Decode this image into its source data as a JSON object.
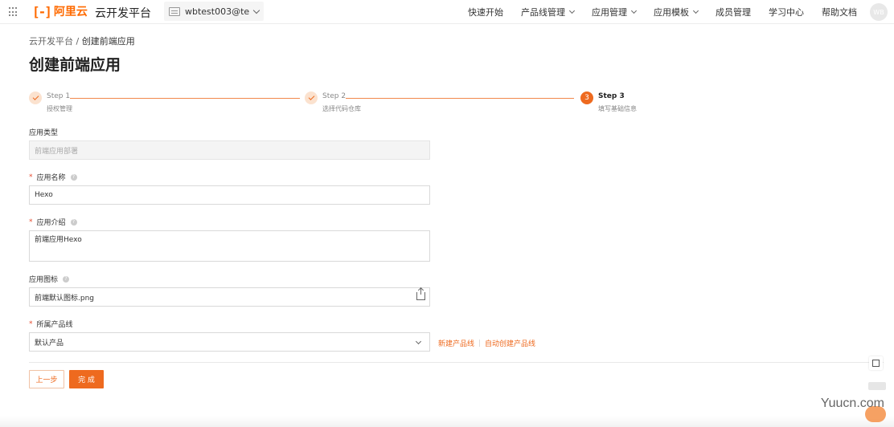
{
  "topbar": {
    "logo_mark": "[-]",
    "logo_text": "阿里云",
    "platform": "云开发平台",
    "account": "wbtest003@te...",
    "nav": [
      {
        "label": "快速开始",
        "dropdown": false
      },
      {
        "label": "产品线管理",
        "dropdown": true
      },
      {
        "label": "应用管理",
        "dropdown": true
      },
      {
        "label": "应用模板",
        "dropdown": true
      },
      {
        "label": "成员管理",
        "dropdown": false
      },
      {
        "label": "学习中心",
        "dropdown": false
      },
      {
        "label": "帮助文档",
        "dropdown": false
      }
    ],
    "avatar": "WB"
  },
  "breadcrumb": {
    "root": "云开发平台",
    "sep": " / ",
    "current": "创建前端应用"
  },
  "page_title": "创建前端应用",
  "steps": [
    {
      "title": "Step 1",
      "desc": "授权管理",
      "status": "done",
      "num": ""
    },
    {
      "title": "Step 2",
      "desc": "选择代码仓库",
      "status": "done",
      "num": ""
    },
    {
      "title": "Step 3",
      "desc": "填写基础信息",
      "status": "active",
      "num": "3"
    }
  ],
  "form": {
    "type_label": "应用类型",
    "type_value": "前端应用部署",
    "name_label": "应用名称",
    "name_value": "Hexo",
    "intro_label": "应用介绍",
    "intro_value": "前端应用Hexo",
    "icon_label": "应用图标",
    "icon_value": "前端默认图标.png",
    "product_label": "所属产品线",
    "product_value": "默认产品",
    "new_product_link": "新建产品线",
    "auto_product_link": "自动创建产品线",
    "required_mark": "*"
  },
  "buttons": {
    "prev": "上一步",
    "done": "完 成"
  },
  "watermark": "Yuucn.com",
  "colors": {
    "accent": "#ee6a1f",
    "brand": "#ff6a00"
  }
}
